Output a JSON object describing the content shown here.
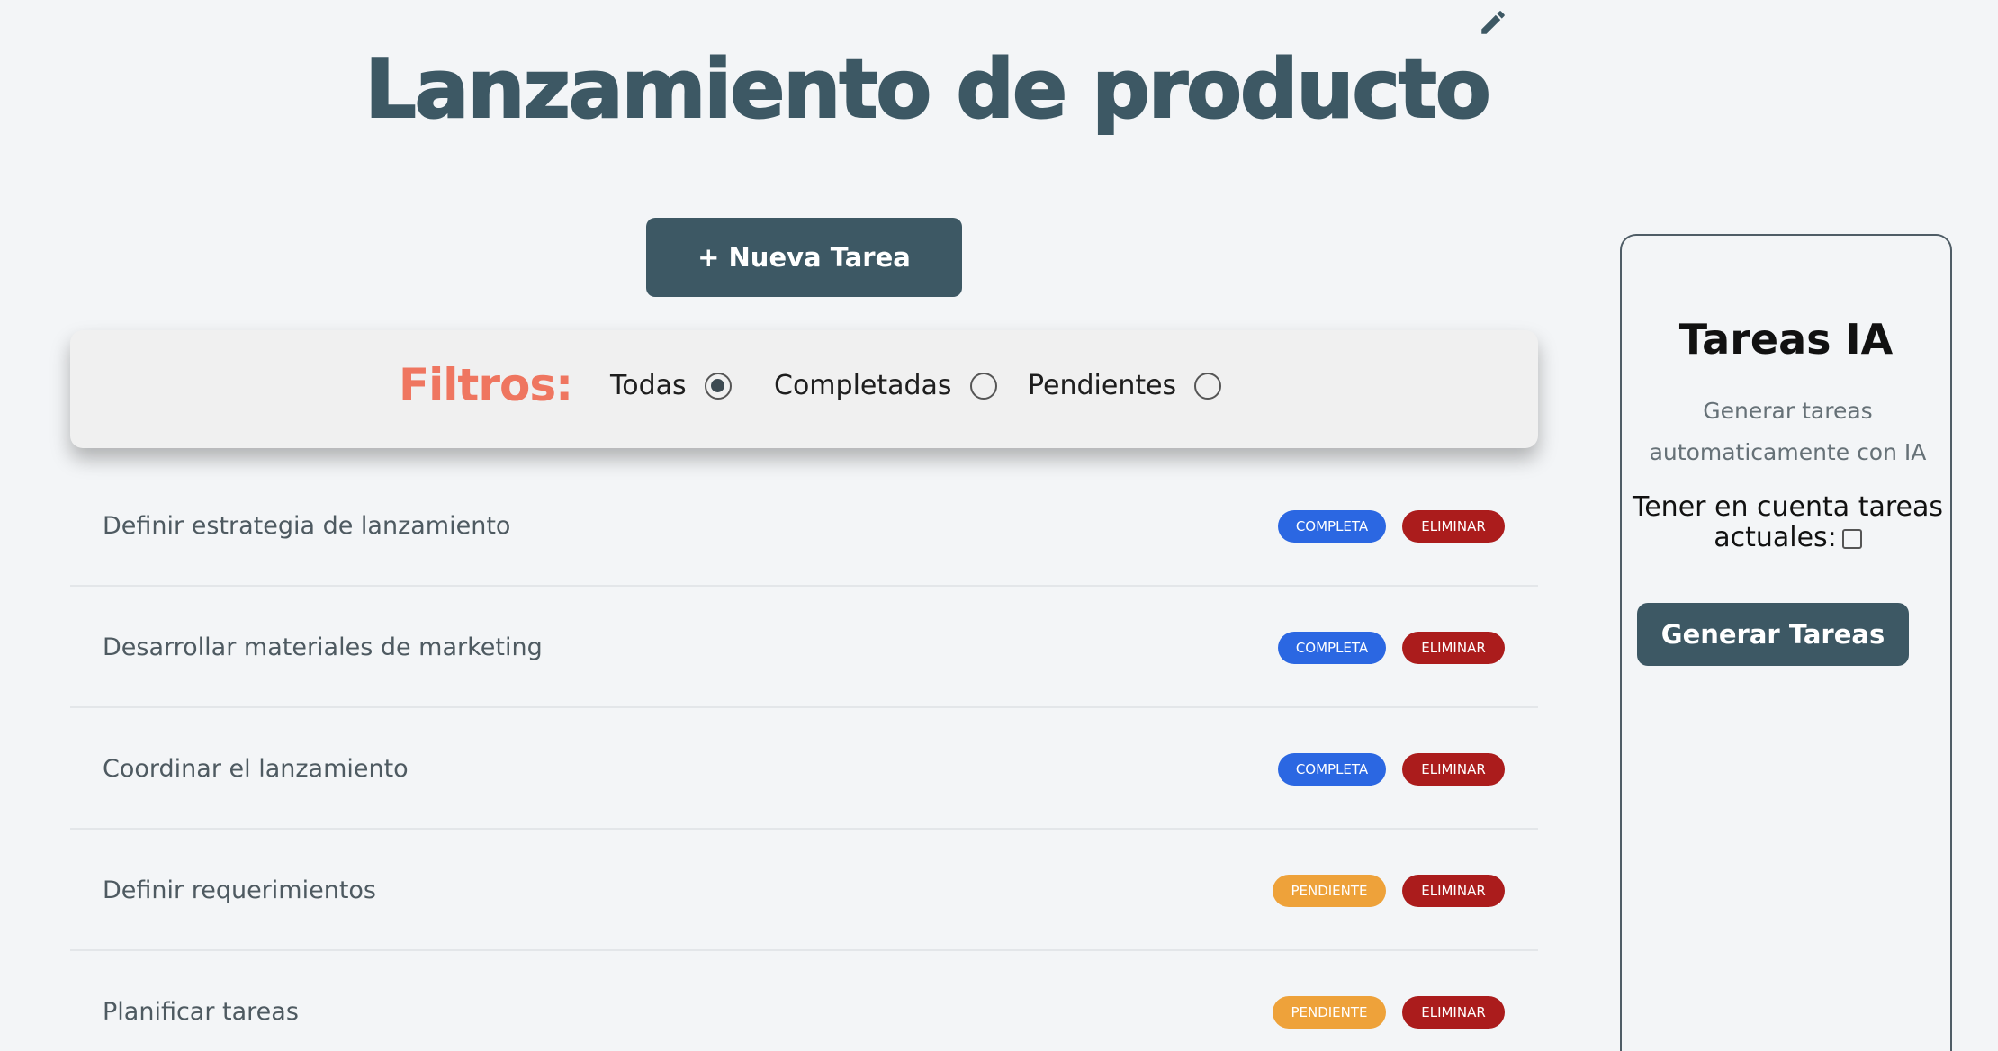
{
  "header": {
    "title": "Lanzamiento de producto",
    "edit_icon": "pencil-icon"
  },
  "toolbar": {
    "new_task_label": "+ Nueva Tarea"
  },
  "filters": {
    "label": "Filtros:",
    "options": [
      {
        "label": "Todas",
        "checked": true
      },
      {
        "label": "Completadas",
        "checked": false
      },
      {
        "label": "Pendientes",
        "checked": false
      }
    ]
  },
  "tasks": [
    {
      "title": "Definir estrategia de lanzamiento",
      "status": "COMPLETA",
      "delete_label": "ELIMINAR"
    },
    {
      "title": "Desarrollar materiales de marketing",
      "status": "COMPLETA",
      "delete_label": "ELIMINAR"
    },
    {
      "title": "Coordinar el lanzamiento",
      "status": "COMPLETA",
      "delete_label": "ELIMINAR"
    },
    {
      "title": "Definir requerimientos",
      "status": "PENDIENTE",
      "delete_label": "ELIMINAR"
    },
    {
      "title": "Planificar tareas",
      "status": "PENDIENTE",
      "delete_label": "ELIMINAR"
    }
  ],
  "ai_panel": {
    "title": "Tareas IA",
    "subtitle": "Generar tareas automaticamente con IA",
    "checkbox_label": "Tener en cuenta tareas actuales:",
    "checkbox_checked": false,
    "generate_label": "Generar Tareas"
  },
  "colors": {
    "primary": "#3d5864",
    "filters_accent": "#ef7660",
    "status_complete": "#2b67e2",
    "status_pending": "#eea23a",
    "delete": "#ab1c1c"
  }
}
